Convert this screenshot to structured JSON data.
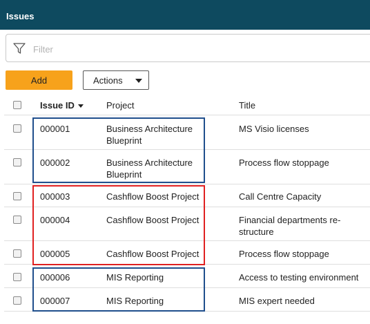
{
  "header": {
    "title": "Issues"
  },
  "filter": {
    "placeholder": "Filter",
    "icon": "filter-icon"
  },
  "toolbar": {
    "add_label": "Add",
    "actions_label": "Actions",
    "add_color": "#f7a21b"
  },
  "table": {
    "columns": {
      "id": "Issue ID",
      "project": "Project",
      "title": "Title"
    },
    "sort": {
      "column": "Issue ID",
      "direction": "descending"
    },
    "rows": [
      {
        "id": "000001",
        "project": "Business Architecture Blueprint",
        "title": "MS Visio licenses"
      },
      {
        "id": "000002",
        "project": "Business Architecture Blueprint",
        "title": "Process flow stoppage"
      },
      {
        "id": "000003",
        "project": "Cashflow Boost Project",
        "title": "Call Centre Capacity"
      },
      {
        "id": "000004",
        "project": "Cashflow Boost Project",
        "title": "Financial departments re-structure"
      },
      {
        "id": "000005",
        "project": "Cashflow Boost Project",
        "title": "Process flow stoppage"
      },
      {
        "id": "000006",
        "project": "MIS Reporting",
        "title": "Access to testing environment"
      },
      {
        "id": "000007",
        "project": "MIS Reporting",
        "title": "MIS expert needed"
      }
    ]
  },
  "highlight_colors": {
    "blue": "#1f4e8c",
    "red": "#e02020"
  },
  "header_color": "#0e4a5f"
}
